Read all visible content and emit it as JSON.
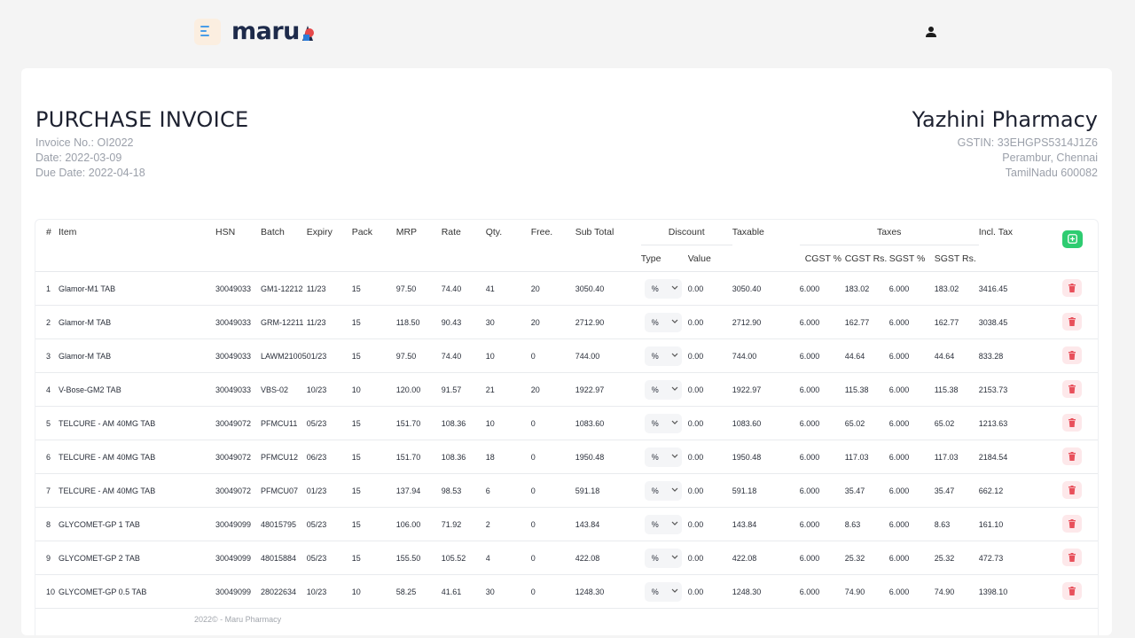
{
  "app": {
    "logo": "maru"
  },
  "invoice": {
    "title": "PURCHASE INVOICE",
    "number": "Invoice No.: OI2022",
    "date": "Date: 2022-03-09",
    "due_date": "Due Date: 2022-04-18"
  },
  "company": {
    "name": "Yazhini Pharmacy",
    "gstin": "GSTIN: 33EHGPS5314J1Z6",
    "address1": "Perambur, Chennai",
    "address2": "TamilNadu 600082"
  },
  "table": {
    "headers": {
      "no": "#",
      "item": "Item",
      "hsn": "HSN",
      "batch": "Batch",
      "expiry": "Expiry",
      "pack": "Pack",
      "mrp": "MRP",
      "rate": "Rate",
      "qty": "Qty.",
      "free": "Free.",
      "subtotal": "Sub Total",
      "discount": "Discount",
      "disc_type": "Type",
      "disc_value": "Value",
      "taxable": "Taxable",
      "taxes": "Taxes",
      "cgst_pct": "CGST %",
      "cgst_rs": "CGST Rs.",
      "sgst_pct": "SGST %",
      "sgst_rs": "SGST Rs.",
      "incl_tax": "Incl. Tax"
    },
    "rows": [
      {
        "no": "1",
        "item": "Glamor-M1 TAB",
        "hsn": "30049033",
        "batch": "GM1-12212",
        "expiry": "11/23",
        "pack": "15",
        "mrp": "97.50",
        "rate": "74.40",
        "qty": "41",
        "free": "20",
        "subtotal": "3050.40",
        "disc_type": "%",
        "disc_value": "0.00",
        "taxable": "3050.40",
        "cgst_pct": "6.000",
        "cgst_rs": "183.02",
        "sgst_pct": "6.000",
        "sgst_rs": "183.02",
        "incl": "3416.45"
      },
      {
        "no": "2",
        "item": "Glamor-M TAB",
        "hsn": "30049033",
        "batch": "GRM-12211",
        "expiry": "11/23",
        "pack": "15",
        "mrp": "118.50",
        "rate": "90.43",
        "qty": "30",
        "free": "20",
        "subtotal": "2712.90",
        "disc_type": "%",
        "disc_value": "0.00",
        "taxable": "2712.90",
        "cgst_pct": "6.000",
        "cgst_rs": "162.77",
        "sgst_pct": "6.000",
        "sgst_rs": "162.77",
        "incl": "3038.45"
      },
      {
        "no": "3",
        "item": "Glamor-M TAB",
        "hsn": "30049033",
        "batch": "LAWM21005",
        "expiry": "01/23",
        "pack": "15",
        "mrp": "97.50",
        "rate": "74.40",
        "qty": "10",
        "free": "0",
        "subtotal": "744.00",
        "disc_type": "%",
        "disc_value": "0.00",
        "taxable": "744.00",
        "cgst_pct": "6.000",
        "cgst_rs": "44.64",
        "sgst_pct": "6.000",
        "sgst_rs": "44.64",
        "incl": "833.28"
      },
      {
        "no": "4",
        "item": "V-Bose-GM2 TAB",
        "hsn": "30049033",
        "batch": "VBS-02",
        "expiry": "10/23",
        "pack": "10",
        "mrp": "120.00",
        "rate": "91.57",
        "qty": "21",
        "free": "20",
        "subtotal": "1922.97",
        "disc_type": "%",
        "disc_value": "0.00",
        "taxable": "1922.97",
        "cgst_pct": "6.000",
        "cgst_rs": "115.38",
        "sgst_pct": "6.000",
        "sgst_rs": "115.38",
        "incl": "2153.73"
      },
      {
        "no": "5",
        "item": "TELCURE - AM 40MG TAB",
        "hsn": "30049072",
        "batch": "PFMCU11",
        "expiry": "05/23",
        "pack": "15",
        "mrp": "151.70",
        "rate": "108.36",
        "qty": "10",
        "free": "0",
        "subtotal": "1083.60",
        "disc_type": "%",
        "disc_value": "0.00",
        "taxable": "1083.60",
        "cgst_pct": "6.000",
        "cgst_rs": "65.02",
        "sgst_pct": "6.000",
        "sgst_rs": "65.02",
        "incl": "1213.63"
      },
      {
        "no": "6",
        "item": "TELCURE - AM 40MG TAB",
        "hsn": "30049072",
        "batch": "PFMCU12",
        "expiry": "06/23",
        "pack": "15",
        "mrp": "151.70",
        "rate": "108.36",
        "qty": "18",
        "free": "0",
        "subtotal": "1950.48",
        "disc_type": "%",
        "disc_value": "0.00",
        "taxable": "1950.48",
        "cgst_pct": "6.000",
        "cgst_rs": "117.03",
        "sgst_pct": "6.000",
        "sgst_rs": "117.03",
        "incl": "2184.54"
      },
      {
        "no": "7",
        "item": "TELCURE - AM 40MG TAB",
        "hsn": "30049072",
        "batch": "PFMCU07",
        "expiry": "01/23",
        "pack": "15",
        "mrp": "137.94",
        "rate": "98.53",
        "qty": "6",
        "free": "0",
        "subtotal": "591.18",
        "disc_type": "%",
        "disc_value": "0.00",
        "taxable": "591.18",
        "cgst_pct": "6.000",
        "cgst_rs": "35.47",
        "sgst_pct": "6.000",
        "sgst_rs": "35.47",
        "incl": "662.12"
      },
      {
        "no": "8",
        "item": "GLYCOMET-GP 1 TAB",
        "hsn": "30049099",
        "batch": "48015795",
        "expiry": "05/23",
        "pack": "15",
        "mrp": "106.00",
        "rate": "71.92",
        "qty": "2",
        "free": "0",
        "subtotal": "143.84",
        "disc_type": "%",
        "disc_value": "0.00",
        "taxable": "143.84",
        "cgst_pct": "6.000",
        "cgst_rs": "8.63",
        "sgst_pct": "6.000",
        "sgst_rs": "8.63",
        "incl": "161.10"
      },
      {
        "no": "9",
        "item": "GLYCOMET-GP 2 TAB",
        "hsn": "30049099",
        "batch": "48015884",
        "expiry": "05/23",
        "pack": "15",
        "mrp": "155.50",
        "rate": "105.52",
        "qty": "4",
        "free": "0",
        "subtotal": "422.08",
        "disc_type": "%",
        "disc_value": "0.00",
        "taxable": "422.08",
        "cgst_pct": "6.000",
        "cgst_rs": "25.32",
        "sgst_pct": "6.000",
        "sgst_rs": "25.32",
        "incl": "472.73"
      },
      {
        "no": "10",
        "item": "GLYCOMET-GP 0.5 TAB",
        "hsn": "30049099",
        "batch": "28022634",
        "expiry": "10/23",
        "pack": "10",
        "mrp": "58.25",
        "rate": "41.61",
        "qty": "30",
        "free": "0",
        "subtotal": "1248.30",
        "disc_type": "%",
        "disc_value": "0.00",
        "taxable": "1248.30",
        "cgst_pct": "6.000",
        "cgst_rs": "74.90",
        "sgst_pct": "6.000",
        "sgst_rs": "74.90",
        "incl": "1398.10"
      }
    ]
  },
  "footer": {
    "text": "2022© - Maru Pharmacy"
  },
  "icons": {
    "menu": "menu-icon",
    "user": "user-icon",
    "add": "plus-square-icon",
    "delete": "trash-icon",
    "select": "chevron-down-icon"
  },
  "colors": {
    "brand_dark": "#1d2a4a",
    "add_green": "#2ecc71",
    "delete_bg": "#fde8ea",
    "delete_fg": "#e8505b",
    "menu_blue": "#4a9de8"
  }
}
